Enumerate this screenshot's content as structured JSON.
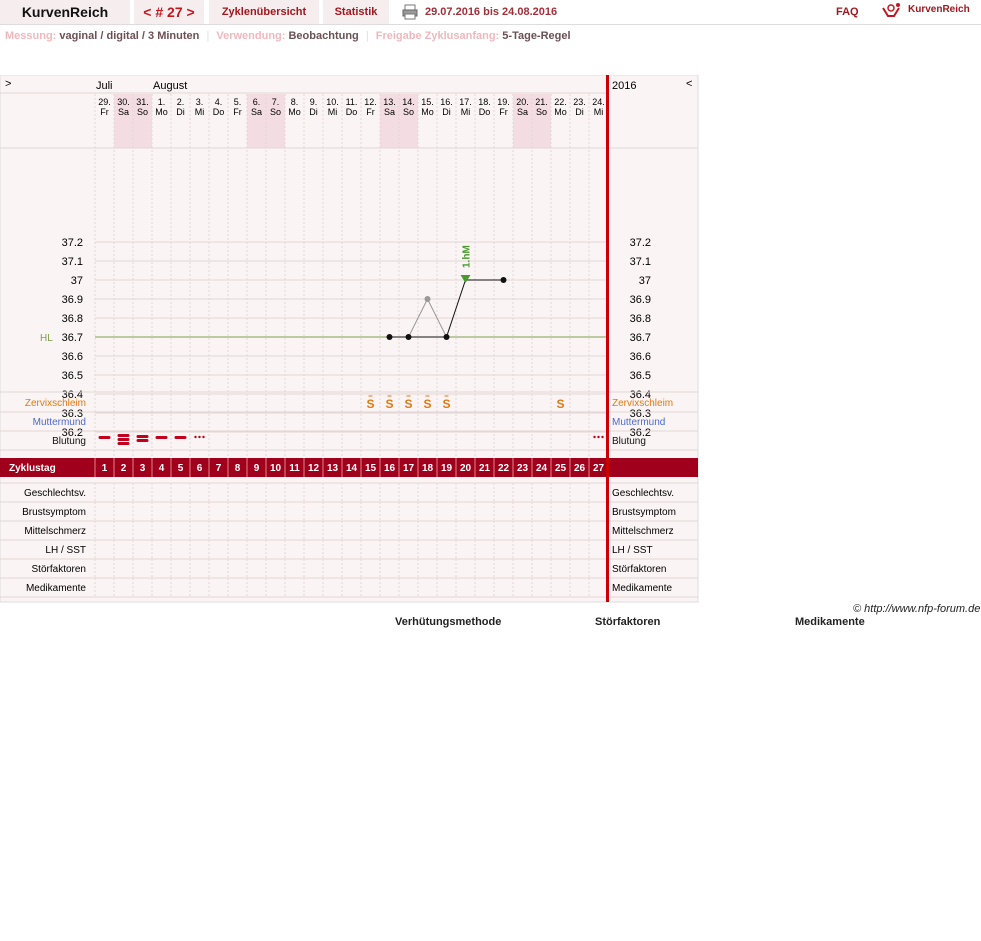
{
  "app": {
    "name": "KurvenReich",
    "logo_text": "KurvenReich"
  },
  "nav": {
    "cycle": "< # 27 >",
    "overview": "Zyklenübersicht",
    "stats": "Statistik",
    "date_range": "29.07.2016 bis 24.08.2016",
    "faq": "FAQ"
  },
  "info": {
    "measurement_label": "Messung:",
    "measurement": "vaginal / digital / 3 Minuten",
    "usage_label": "Verwendung:",
    "usage": "Beobachtung",
    "release_label": "Freigabe Zyklusanfang:",
    "release": "5-Tage-Regel"
  },
  "chart_header": {
    "left_arrow": ">",
    "right_arrow": "<",
    "year": "2016",
    "month_labels": [
      {
        "text": "Juli",
        "day_index": 0
      },
      {
        "text": "August",
        "day_index": 3
      }
    ]
  },
  "days": [
    {
      "date": "29.",
      "wd": "Fr",
      "cd": 1,
      "weekend": false
    },
    {
      "date": "30.",
      "wd": "Sa",
      "cd": 2,
      "weekend": true
    },
    {
      "date": "31.",
      "wd": "So",
      "cd": 3,
      "weekend": true
    },
    {
      "date": "1.",
      "wd": "Mo",
      "cd": 4,
      "weekend": false
    },
    {
      "date": "2.",
      "wd": "Di",
      "cd": 5,
      "weekend": false
    },
    {
      "date": "3.",
      "wd": "Mi",
      "cd": 6,
      "weekend": false
    },
    {
      "date": "4.",
      "wd": "Do",
      "cd": 7,
      "weekend": false
    },
    {
      "date": "5.",
      "wd": "Fr",
      "cd": 8,
      "weekend": false
    },
    {
      "date": "6.",
      "wd": "Sa",
      "cd": 9,
      "weekend": true
    },
    {
      "date": "7.",
      "wd": "So",
      "cd": 10,
      "weekend": true
    },
    {
      "date": "8.",
      "wd": "Mo",
      "cd": 11,
      "weekend": false
    },
    {
      "date": "9.",
      "wd": "Di",
      "cd": 12,
      "weekend": false
    },
    {
      "date": "10.",
      "wd": "Mi",
      "cd": 13,
      "weekend": false
    },
    {
      "date": "11.",
      "wd": "Do",
      "cd": 14,
      "weekend": false
    },
    {
      "date": "12.",
      "wd": "Fr",
      "cd": 15,
      "weekend": false
    },
    {
      "date": "13.",
      "wd": "Sa",
      "cd": 16,
      "weekend": true
    },
    {
      "date": "14.",
      "wd": "So",
      "cd": 17,
      "weekend": true
    },
    {
      "date": "15.",
      "wd": "Mo",
      "cd": 18,
      "weekend": false
    },
    {
      "date": "16.",
      "wd": "Di",
      "cd": 19,
      "weekend": false
    },
    {
      "date": "17.",
      "wd": "Mi",
      "cd": 20,
      "weekend": false
    },
    {
      "date": "18.",
      "wd": "Do",
      "cd": 21,
      "weekend": false
    },
    {
      "date": "19.",
      "wd": "Fr",
      "cd": 22,
      "weekend": false
    },
    {
      "date": "20.",
      "wd": "Sa",
      "cd": 23,
      "weekend": true
    },
    {
      "date": "21.",
      "wd": "So",
      "cd": 24,
      "weekend": true
    },
    {
      "date": "22.",
      "wd": "Mo",
      "cd": 25,
      "weekend": false
    },
    {
      "date": "23.",
      "wd": "Di",
      "cd": 26,
      "weekend": false
    },
    {
      "date": "24.",
      "wd": "Mi",
      "cd": 27,
      "weekend": false
    }
  ],
  "chart_data": {
    "type": "line",
    "y_ticks": [
      "37.2",
      "37.1",
      "37",
      "36.9",
      "36.8",
      "36.7",
      "36.6",
      "36.5",
      "36.4",
      "36.3",
      "36.2"
    ],
    "ylim": [
      36.1,
      37.3
    ],
    "hl_label": "HL",
    "hl_value": 36.7,
    "series": [
      {
        "points": [
          {
            "day": 16,
            "temp": 36.7
          },
          {
            "day": 17,
            "temp": 36.7
          },
          {
            "day": 18,
            "temp": 36.9,
            "excluded": true
          },
          {
            "day": 19,
            "temp": 36.7
          },
          {
            "day": 20,
            "temp": 37.0
          },
          {
            "day": 22,
            "temp": 37.0
          }
        ]
      }
    ],
    "annotation": {
      "day": 20,
      "text": "1.hM"
    }
  },
  "rows": {
    "cervix_label": "Zervixschleim",
    "cervix_color": "#e07a12",
    "cervix": [
      {
        "day": 15,
        "sym": "S̈"
      },
      {
        "day": 16,
        "sym": "S̈"
      },
      {
        "day": 17,
        "sym": "S̈"
      },
      {
        "day": 18,
        "sym": "S̈"
      },
      {
        "day": 19,
        "sym": "S̈"
      },
      {
        "day": 25,
        "sym": "S"
      }
    ],
    "cervix_display": [
      "S",
      "S",
      "S",
      "S",
      "S",
      "S"
    ],
    "muttermund_label": "Muttermund",
    "muttermund_color": "#4a6ad0",
    "blutung_label": "Blutung",
    "blutung": [
      {
        "day": 1,
        "level": "dash"
      },
      {
        "day": 2,
        "level": "heavy"
      },
      {
        "day": 3,
        "level": "medium"
      },
      {
        "day": 4,
        "level": "dash"
      },
      {
        "day": 5,
        "level": "dash"
      },
      {
        "day": 6,
        "level": "dots"
      },
      {
        "day": 27,
        "level": "dots"
      }
    ],
    "zyklustag_label": "Zyklustag",
    "lower": [
      "Geschlechtsv.",
      "Brustsymptom",
      "Mittelschmerz",
      "LH / SST",
      "Störfaktoren",
      "Medikamente"
    ]
  },
  "footer": {
    "copyright": "© http://www.nfp-forum.de",
    "captions": [
      "Verhütungsmethode",
      "Störfaktoren",
      "Medikamente"
    ]
  },
  "colors": {
    "accent": "#a0001c",
    "weekend": "#f3dde2",
    "panel": "#faf4f4",
    "grid": "#e2d6d6",
    "hl": "#7fa050",
    "marker_green": "#4a9a30",
    "red_line": "#cc0000"
  }
}
